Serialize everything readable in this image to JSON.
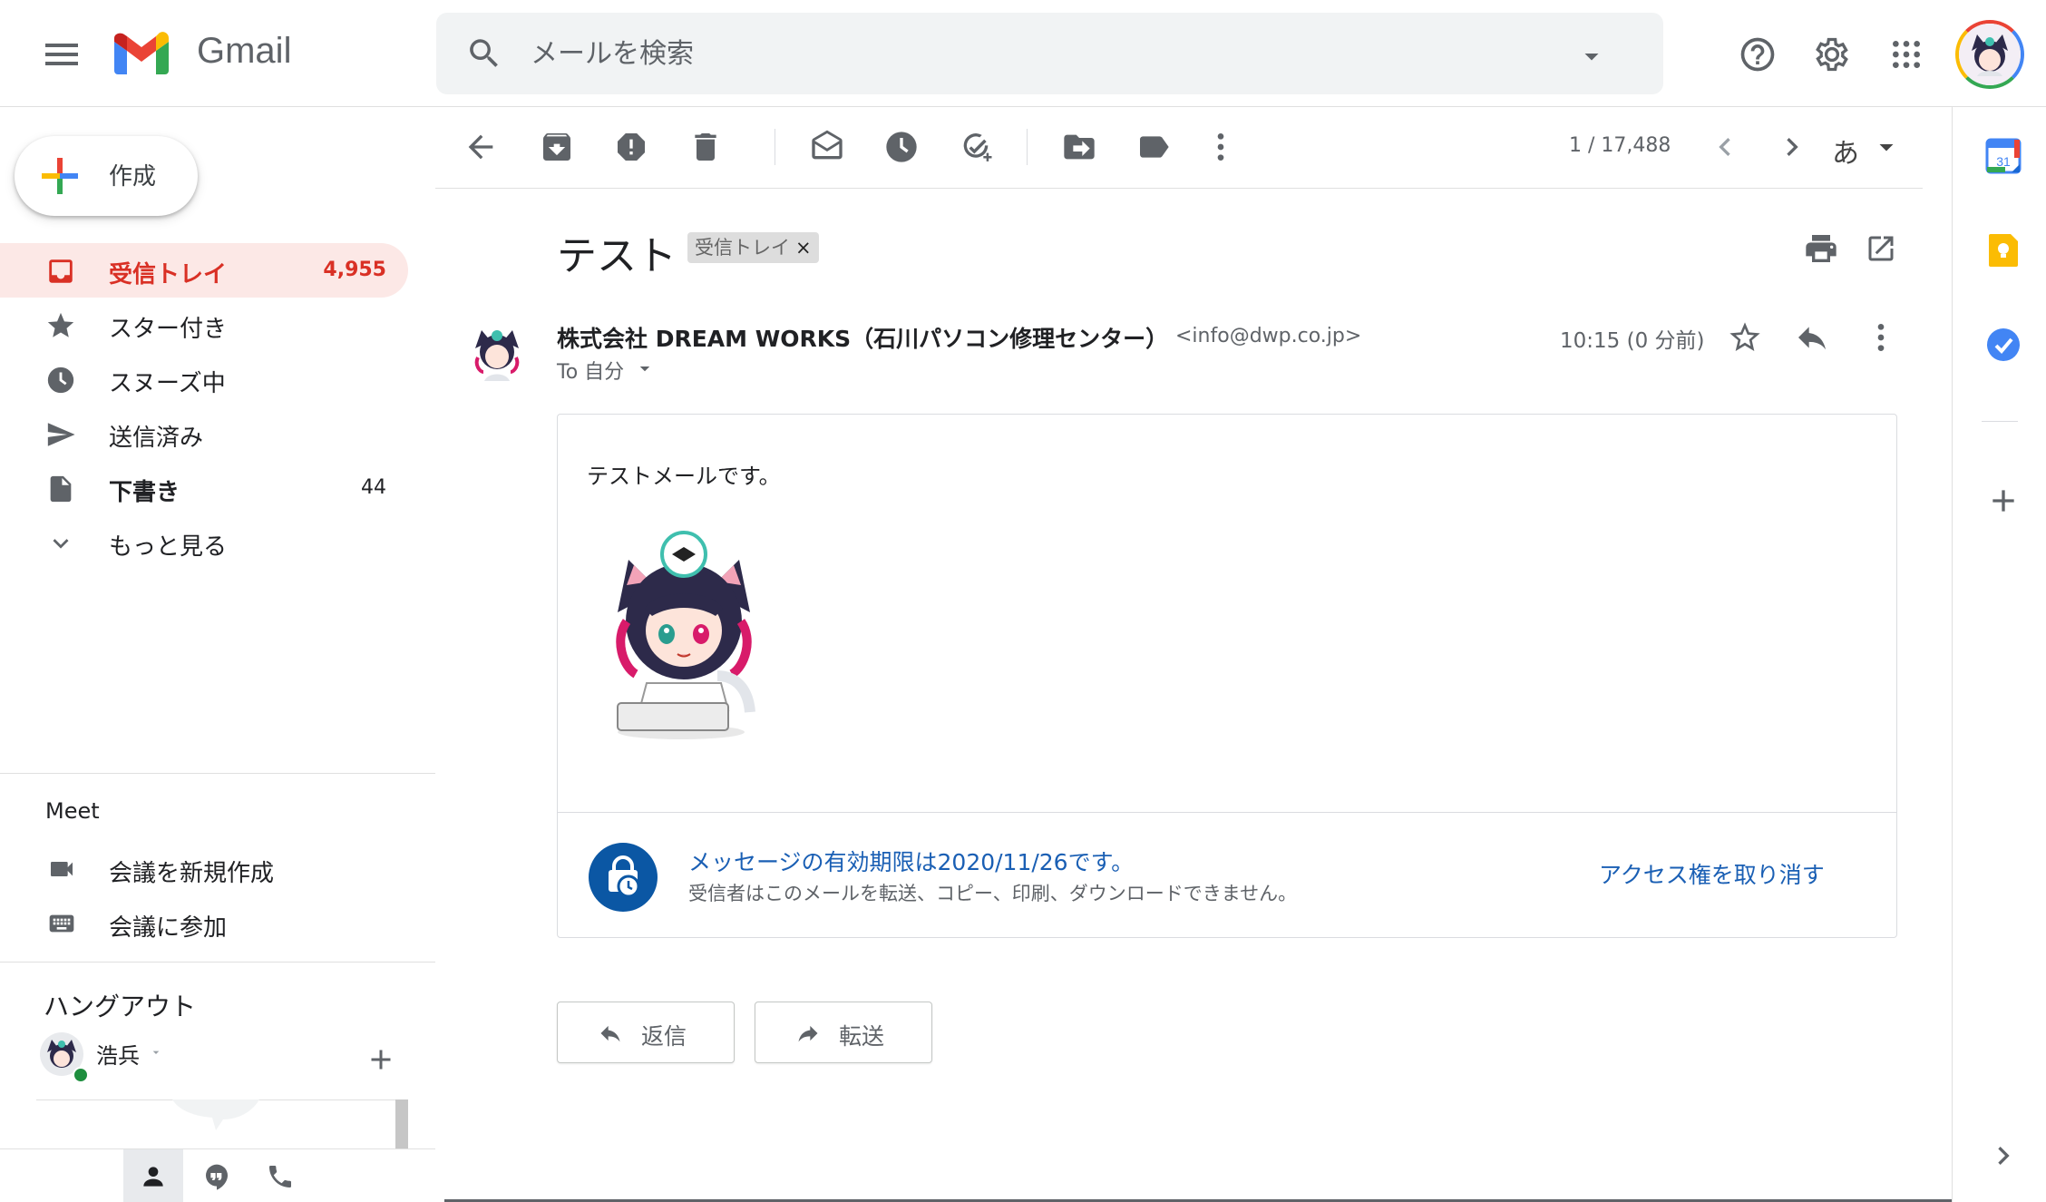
{
  "app": {
    "brand": "Gmail"
  },
  "search": {
    "placeholder": "メールを検索"
  },
  "compose": {
    "label": "作成"
  },
  "nav": {
    "items": [
      {
        "label": "受信トレイ",
        "count": "4,955"
      },
      {
        "label": "スター付き",
        "count": ""
      },
      {
        "label": "スヌーズ中",
        "count": ""
      },
      {
        "label": "送信済み",
        "count": ""
      },
      {
        "label": "下書き",
        "count": "44"
      },
      {
        "label": "もっと見る",
        "count": ""
      }
    ]
  },
  "meet": {
    "title": "Meet",
    "new_meeting": "会議を新規作成",
    "join_meeting": "会議に参加"
  },
  "hangouts": {
    "title": "ハングアウト",
    "user_name": "浩兵"
  },
  "toolbar": {
    "page_counter": "1 / 17,488",
    "input_tool": "あ"
  },
  "message": {
    "subject": "テスト",
    "label_chip": "受信トレイ",
    "label_chip_close": "×",
    "sender_name": "株式会社 DREAM WORKS（石川パソコン修理センター）",
    "sender_email": "<info@dwp.co.jp>",
    "recipient": "To 自分",
    "timestamp": "10:15 (0 分前)",
    "body_text": "テストメールです。",
    "confidential": {
      "title": "メッセージの有効期限は2020/11/26です。",
      "description": "受信者はこのメールを転送、コピー、印刷、ダウンロードできません。",
      "revoke": "アクセス権を取り消す"
    }
  },
  "actions": {
    "reply": "返信",
    "forward": "転送"
  },
  "side_panel": {
    "calendar_day": "31"
  },
  "colors": {
    "inbox_active_bg": "#fce8e6",
    "inbox_active_text": "#d93025",
    "link_blue": "#1a5fb4",
    "confidential_icon_bg": "#0b57a4"
  },
  "icons": [
    "menu-icon",
    "gmail-logo",
    "search-icon",
    "dropdown-icon",
    "help-icon",
    "settings-icon",
    "apps-icon",
    "inbox-icon",
    "star-icon",
    "clock-icon",
    "send-icon",
    "draft-icon",
    "chevron-down-icon",
    "video-icon",
    "keyboard-icon",
    "back-icon",
    "archive-icon",
    "spam-icon",
    "delete-icon",
    "mark-unread-icon",
    "snooze-icon",
    "add-task-icon",
    "move-to-icon",
    "label-icon",
    "more-icon",
    "print-icon",
    "popout-icon",
    "reply-icon",
    "forward-icon",
    "calendar-icon",
    "keep-icon",
    "tasks-icon",
    "plus-icon",
    "person-icon",
    "chat-icon",
    "phone-icon"
  ]
}
